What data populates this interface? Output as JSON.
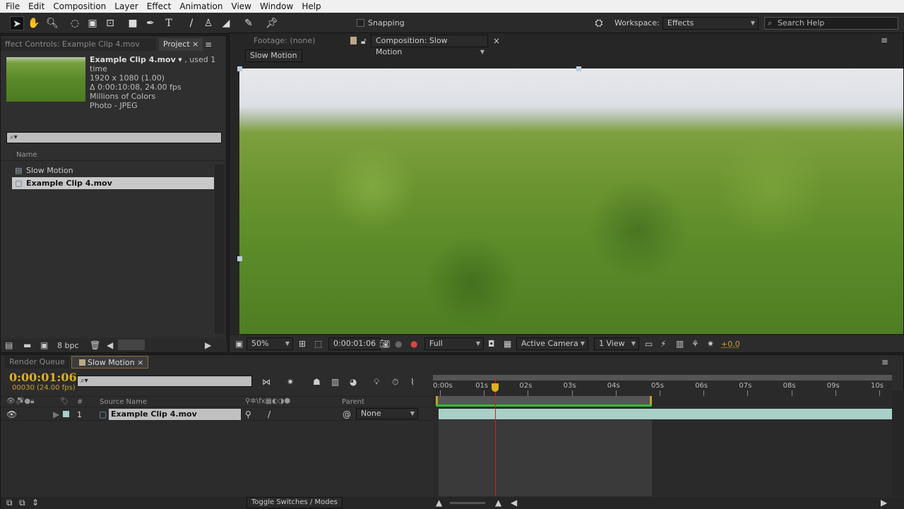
{
  "menu": [
    "File",
    "Edit",
    "Composition",
    "Layer",
    "Effect",
    "Animation",
    "View",
    "Window",
    "Help"
  ],
  "toolbar": {
    "snapping": "Snapping",
    "workspace_label": "Workspace:",
    "workspace_value": "Effects",
    "search_placeholder": "Search Help"
  },
  "left_panel": {
    "tab_effect_controls": "ffect Controls: Example Clip 4.mov",
    "tab_project": "Project",
    "file_name": "Example Clip 4.mov",
    "file_used": ", used 1 time",
    "file_dims": "1920 x 1080 (1.00)",
    "file_duration": "Δ 0:00:10:08, 24.00 fps",
    "file_colors": "Millions of Colors",
    "file_type": "Photo - JPEG",
    "column_name": "Name",
    "items": [
      {
        "label": "Slow Motion",
        "type": "composition"
      },
      {
        "label": "Example Clip 4.mov",
        "type": "footage",
        "selected": true
      }
    ],
    "bpc": "8 bpc"
  },
  "viewer": {
    "tab_footage": "Footage: (none)",
    "tab_composition": "Composition: Slow Motion",
    "comp_button": "Slow Motion",
    "zoom": "50%",
    "timecode": "0:00:01:06",
    "resolution": "Full",
    "camera": "Active Camera",
    "views": "1 View",
    "exposure": "+0.0"
  },
  "timeline": {
    "tab_render_queue": "Render Queue",
    "tab_comp": "Slow Motion",
    "timecode": "0:00:01:06",
    "frame_info": "00030 (24.00 fps)",
    "col_number": "#",
    "col_source": "Source Name",
    "col_parent": "Parent",
    "layer": {
      "index": "1",
      "name": "Example Clip 4.mov",
      "parent": "None"
    },
    "ruler": [
      "0:00s",
      "01s",
      "02s",
      "03s",
      "04s",
      "05s",
      "06s",
      "07s",
      "08s",
      "09s",
      "10s"
    ],
    "playhead_seconds": 1.25,
    "work_area_end_seconds": 4.83,
    "toggle_label": "Toggle Switches / Modes"
  },
  "colors": {
    "timecode": "#e0b020",
    "playhead": "#d02020",
    "layer_bar": "#a8d0c8",
    "work_area": "#30c030"
  }
}
